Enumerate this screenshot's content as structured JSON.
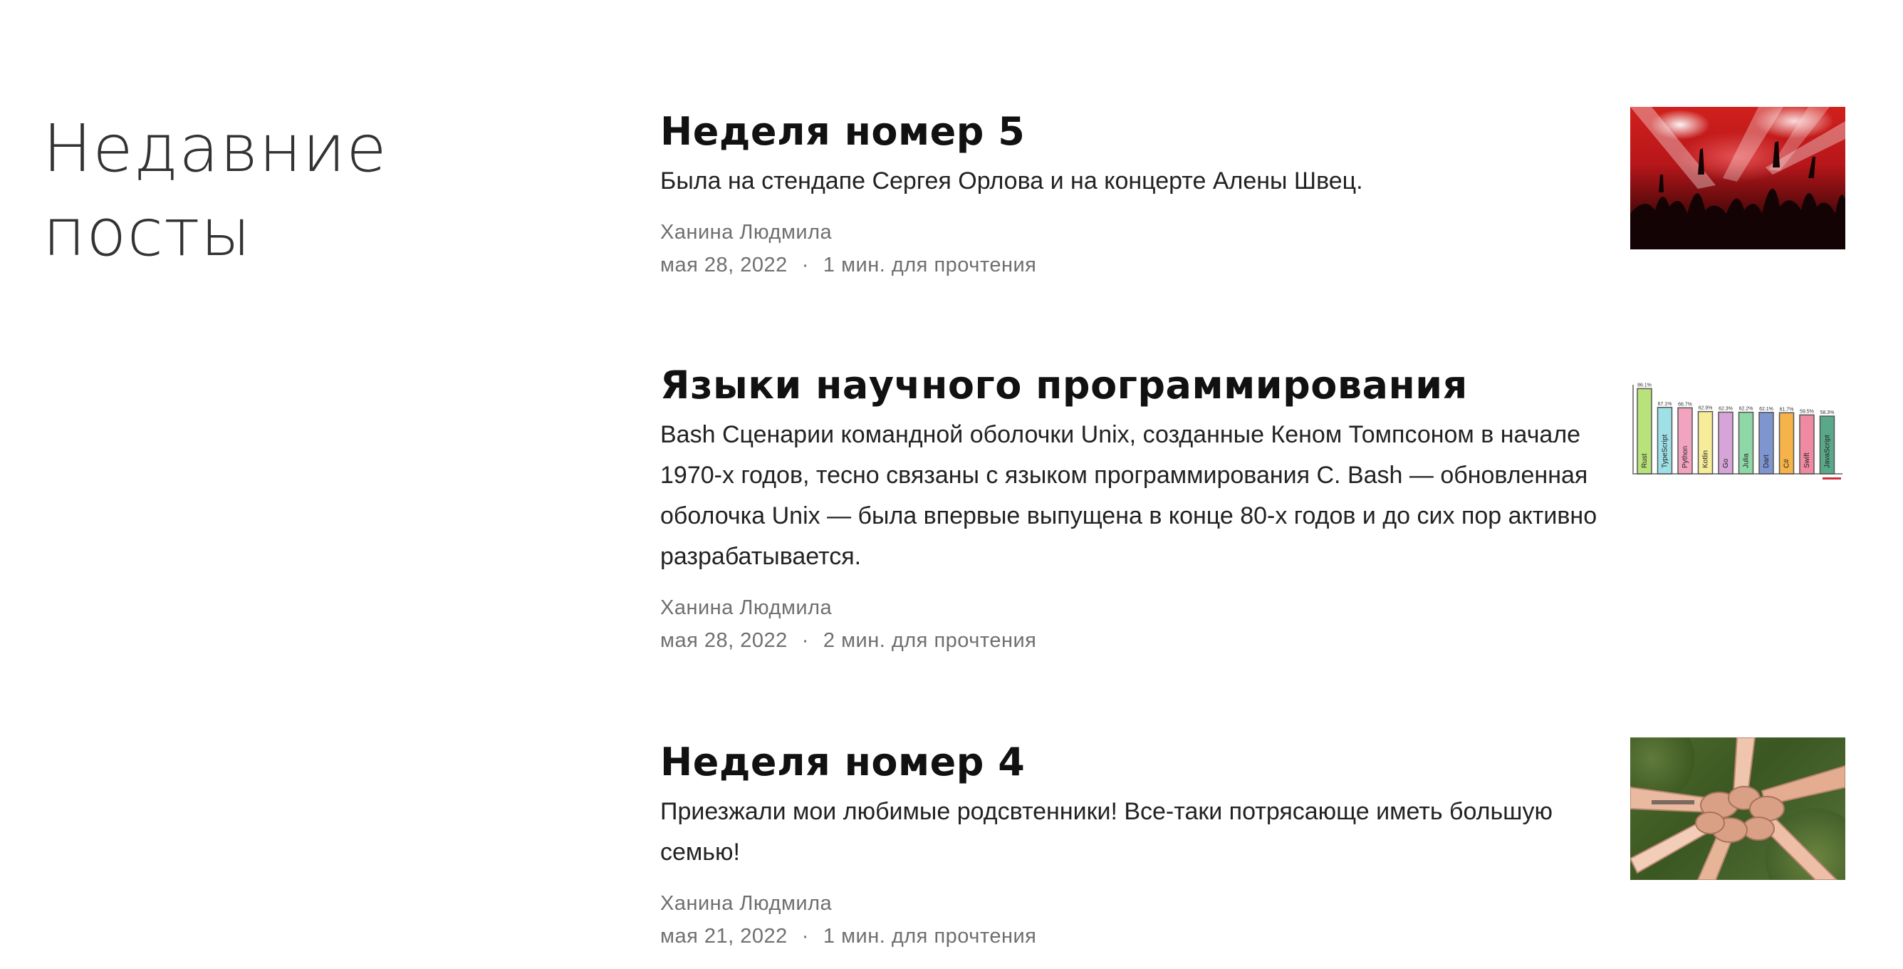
{
  "section": {
    "title": "Недавние посты"
  },
  "posts": [
    {
      "title": "Неделя номер 5",
      "excerpt": "Была на стендапе Сергея Орлова и на концерте Алены Швец.",
      "author": "Ханина Людмила",
      "date": "мая 28, 2022",
      "separator": "·",
      "read_time": "1 мин. для прочтения",
      "thumbnail": "concert-image"
    },
    {
      "title": "Языки научного программирования",
      "excerpt": "Bash Сценарии командной оболочки Unix, созданные Кеном Томпсоном в начале 1970-х годов, тесно связаны с языком программирования C. Bash — обновленная оболочка Unix — была впервые выпущена в конце 80-х годов и до сих пор активно разрабатывается.",
      "author": "Ханина Людмила",
      "date": "мая 28, 2022",
      "separator": "·",
      "read_time": "2 мин. для прочтения",
      "thumbnail": "languages-chart-image",
      "chart_bars": [
        {
          "label": "Rust",
          "value": "86.1%",
          "color": "#b8e27a"
        },
        {
          "label": "TypeScript",
          "value": "67.1%",
          "color": "#9ee0e6"
        },
        {
          "label": "Python",
          "value": "66.7%",
          "color": "#f2a3bf"
        },
        {
          "label": "Kotlin",
          "value": "62.9%",
          "color": "#f6ec9a"
        },
        {
          "label": "Go",
          "value": "62.3%",
          "color": "#d6a4d8"
        },
        {
          "label": "Julia",
          "value": "62.2%",
          "color": "#8ed7a6"
        },
        {
          "label": "Dart",
          "value": "62.1%",
          "color": "#7f95d0"
        },
        {
          "label": "C#",
          "value": "61.7%",
          "color": "#f5b34a"
        },
        {
          "label": "Swift",
          "value": "59.5%",
          "color": "#f08aa2"
        },
        {
          "label": "JavaScript",
          "value": "58.3%",
          "color": "#5aa88a"
        }
      ]
    },
    {
      "title": "Неделя номер 4",
      "excerpt": "Приезжали мои любимые родсвтенники! Все-таки потрясающе иметь большую семью!",
      "author": "Ханина Людмила",
      "date": "мая 21, 2022",
      "separator": "·",
      "read_time": "1 мин. для прочтения",
      "thumbnail": "hands-circle-image"
    }
  ]
}
